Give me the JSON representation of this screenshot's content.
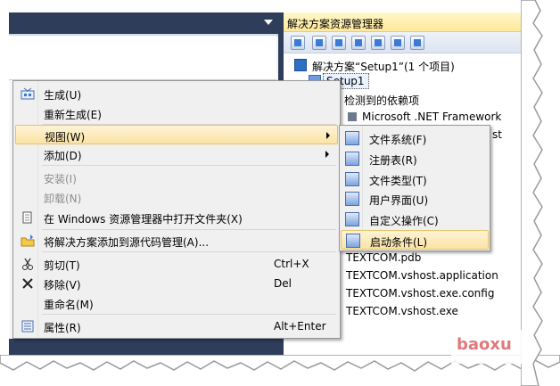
{
  "solution_explorer": {
    "title": "解决方案资源管理器",
    "tree": {
      "solution": "解决方案“Setup1”(1 个项目)",
      "project": "Setup1",
      "dependencies": "检测到的依赖项",
      "framework": "Microsoft .NET Framework",
      "framework_tail": "st",
      "files": [
        "TEXTCOM.pdb",
        "TEXTCOM.vshost.application",
        "TEXTCOM.vshost.exe.config",
        "TEXTCOM.vshost.exe"
      ]
    }
  },
  "context_menu": {
    "items": [
      {
        "label": "生成(U)",
        "icon": "build-icon"
      },
      {
        "label": "重新生成(E)"
      },
      {
        "label": "视图(W)",
        "submenu": true
      },
      {
        "label": "添加(D)",
        "submenu": true
      },
      {
        "label": "安装(I)",
        "disabled": true
      },
      {
        "label": "卸载(N)",
        "disabled": true
      },
      {
        "label": "在 Windows 资源管理器中打开文件夹(X)",
        "icon": "open-folder-icon"
      },
      {
        "label": "将解决方案添加到源代码管理(A)...",
        "icon": "source-control-icon"
      },
      {
        "label": "剪切(T)",
        "shortcut": "Ctrl+X",
        "icon": "scissors-icon"
      },
      {
        "label": "移除(V)",
        "shortcut": "Del",
        "icon": "delete-icon"
      },
      {
        "label": "重命名(M)"
      },
      {
        "label": "属性(R)",
        "shortcut": "Alt+Enter",
        "icon": "properties-icon"
      }
    ]
  },
  "view_submenu": {
    "items": [
      {
        "label": "文件系统(F)",
        "icon": "file-system-icon"
      },
      {
        "label": "注册表(R)",
        "icon": "registry-icon"
      },
      {
        "label": "文件类型(T)",
        "icon": "file-types-icon"
      },
      {
        "label": "用户界面(U)",
        "icon": "user-interface-icon"
      },
      {
        "label": "自定义操作(C)",
        "icon": "custom-actions-icon"
      },
      {
        "label": "启动条件(L)",
        "icon": "launch-conditions-icon"
      }
    ],
    "highlighted": "启动条件(L)"
  },
  "watermark": "baoxu",
  "colors": {
    "menu_highlight": "#fbe3a4",
    "title_dark": "#2e3d5a",
    "se_title_bg": "#ffe89a"
  }
}
